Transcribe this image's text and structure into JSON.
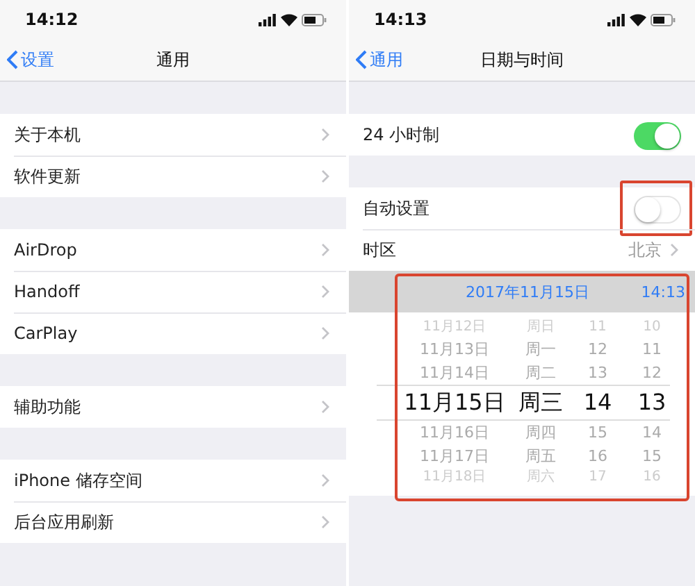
{
  "screens": [
    {
      "status_bar": {
        "time": "14:12"
      },
      "nav": {
        "back": "设置",
        "title": "通用"
      },
      "sections": [
        {
          "kind": "group",
          "rows": [
            {
              "kind": "link",
              "label": "关于本机"
            },
            {
              "kind": "link",
              "label": "软件更新"
            }
          ]
        },
        {
          "kind": "group",
          "rows": [
            {
              "kind": "link",
              "label": "AirDrop"
            },
            {
              "kind": "link",
              "label": "Handoff"
            },
            {
              "kind": "link",
              "label": "CarPlay"
            }
          ]
        },
        {
          "kind": "group",
          "rows": [
            {
              "kind": "link",
              "label": "辅助功能"
            }
          ]
        },
        {
          "kind": "group",
          "rows": [
            {
              "kind": "link",
              "label": "iPhone 储存空间"
            },
            {
              "kind": "link",
              "label": "后台应用刷新"
            }
          ]
        }
      ]
    },
    {
      "status_bar": {
        "time": "14:13"
      },
      "nav": {
        "back": "通用",
        "title": "日期与时间"
      },
      "sections": [
        {
          "kind": "group",
          "rows": [
            {
              "kind": "toggle",
              "label": "24 小时制",
              "on": true,
              "highlighted": false
            }
          ]
        },
        {
          "kind": "group",
          "rows": [
            {
              "kind": "toggle",
              "label": "自动设置",
              "on": false,
              "highlighted": true
            },
            {
              "kind": "value",
              "label": "时区",
              "value": "北京"
            }
          ]
        },
        {
          "kind": "picker",
          "highlighted": true,
          "header": {
            "date": "2017年11月15日",
            "time": "14:13"
          },
          "rows": [
            {
              "date": "11月12日",
              "weekday": "周日",
              "hour": "11",
              "minute": "10",
              "selected": false
            },
            {
              "date": "11月13日",
              "weekday": "周一",
              "hour": "12",
              "minute": "11",
              "selected": false
            },
            {
              "date": "11月14日",
              "weekday": "周二",
              "hour": "13",
              "minute": "12",
              "selected": false
            },
            {
              "date": "11月15日",
              "weekday": "周三",
              "hour": "14",
              "minute": "13",
              "selected": true
            },
            {
              "date": "11月16日",
              "weekday": "周四",
              "hour": "15",
              "minute": "14",
              "selected": false
            },
            {
              "date": "11月17日",
              "weekday": "周五",
              "hour": "16",
              "minute": "15",
              "selected": false
            },
            {
              "date": "11月18日",
              "weekday": "周六",
              "hour": "17",
              "minute": "16",
              "selected": false
            }
          ]
        }
      ]
    }
  ]
}
